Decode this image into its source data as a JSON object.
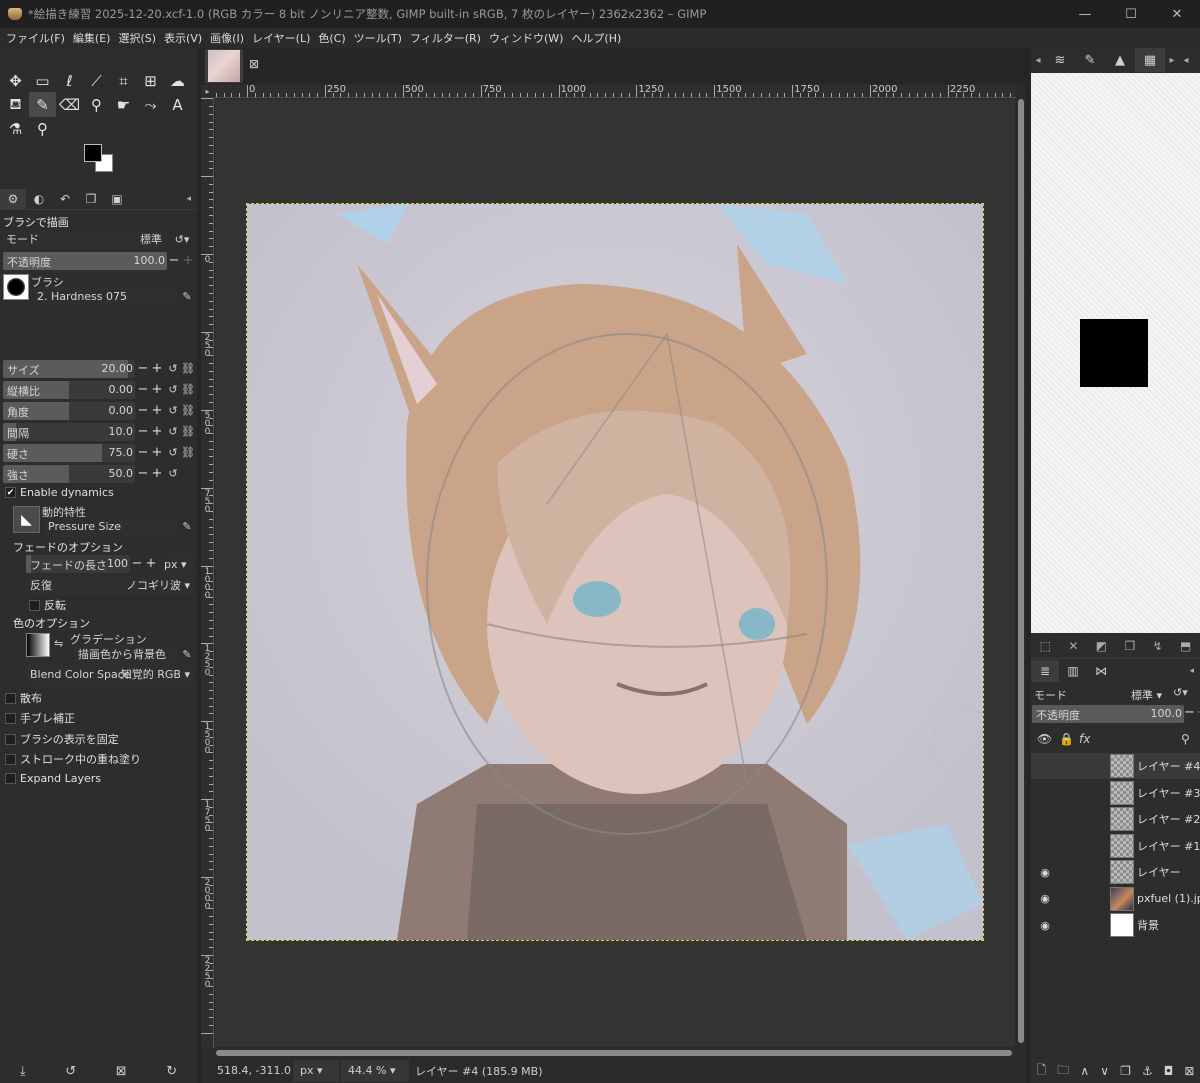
{
  "window": {
    "title": "*絵描き練習 2025-12-20.xcf-1.0 (RGB カラー 8 bit ノンリニア整数, GIMP built-in sRGB, 7 枚のレイヤー) 2362x2362 – GIMP",
    "minimize": "—",
    "maximize": "☐",
    "close": "✕"
  },
  "menubar": [
    "ファイル(F)",
    "編集(E)",
    "選択(S)",
    "表示(V)",
    "画像(I)",
    "レイヤー(L)",
    "色(C)",
    "ツール(T)",
    "フィルター(R)",
    "ウィンドウ(W)",
    "ヘルプ(H)"
  ],
  "toolbox": {
    "row1_icons": [
      "move-icon",
      "rect-select-icon",
      "free-select-icon",
      "fuzzy-select-icon",
      "crop-icon",
      "unified-transform-icon",
      "warp-icon"
    ],
    "row2_icons": [
      "bucket-fill-icon",
      "paintbrush-icon",
      "eraser-icon",
      "clone-icon",
      "smudge-icon",
      "path-icon",
      "text-icon"
    ],
    "row3_icons": [
      "color-picker-icon",
      "zoom-icon"
    ],
    "foreground_color": "#000000",
    "background_color": "#ffffff"
  },
  "tool_options": {
    "title": "ブラシで描画",
    "mode_label": "モード",
    "mode_value": "標準",
    "opacity": {
      "label": "不透明度",
      "value": "100.0"
    },
    "brush_label": "ブラシ",
    "brush_name": "2. Hardness 075",
    "sliders": [
      {
        "label": "サイズ",
        "value": "20.00",
        "fill": 0.95
      },
      {
        "label": "縦横比",
        "value": "0.00",
        "fill": 0.5
      },
      {
        "label": "角度",
        "value": "0.00",
        "fill": 0.5
      },
      {
        "label": "間隔",
        "value": "10.0",
        "fill": 0.1
      },
      {
        "label": "硬さ",
        "value": "75.0",
        "fill": 0.75
      },
      {
        "label": "強さ",
        "value": "50.0",
        "fill": 0.5
      }
    ],
    "enable_dynamics": "Enable dynamics",
    "dynamics_label": "動的特性",
    "dynamics_value": "Pressure Size",
    "fade_options": "フェードのオプション",
    "fade_length_label": "フェードの長さ",
    "fade_length_value": "100",
    "fade_unit": "px",
    "repeat_label": "反復",
    "repeat_value": "ノコギリ波",
    "reverse": "反転",
    "color_options": "色のオプション",
    "gradient_label": "グラデーション",
    "gradient_value": "描画色から背景色 (R",
    "blend_color_space_label": "Blend Color Space",
    "blend_color_space_value": "知覚的 RGB",
    "checkboxes": [
      "散布",
      "手ブレ補正",
      "ブラシの表示を固定",
      "ストローク中の重ね塗り",
      "Expand Layers"
    ]
  },
  "image_window": {
    "ruler_h": [
      "0",
      "250",
      "500",
      "750",
      "1000",
      "1250",
      "1500",
      "1750",
      "2000",
      "2250"
    ],
    "ruler_v": [
      "0",
      "250",
      "500",
      "750",
      "1000",
      "1250",
      "1500",
      "1750",
      "2000",
      "2250"
    ],
    "status": {
      "coords": "518.4, -311.0",
      "unit": "px",
      "zoom": "44.4 %",
      "message": "レイヤー #4 (185.9 MB)"
    }
  },
  "layers": {
    "mode_label": "モード",
    "mode_value": "標準",
    "opacity_label": "不透明度",
    "opacity_value": "100.0",
    "items": [
      {
        "name": "レイヤー #4",
        "visible": false,
        "thumb": "checker",
        "selected": true
      },
      {
        "name": "レイヤー #3",
        "visible": false,
        "thumb": "checker",
        "selected": false
      },
      {
        "name": "レイヤー #2",
        "visible": false,
        "thumb": "checker",
        "selected": false
      },
      {
        "name": "レイヤー #1",
        "visible": false,
        "thumb": "checker",
        "selected": false
      },
      {
        "name": "レイヤー",
        "visible": true,
        "thumb": "checker",
        "selected": false
      },
      {
        "name": "pxfuel (1).jpg",
        "visible": true,
        "thumb": "photo",
        "selected": false
      },
      {
        "name": "背景",
        "visible": true,
        "thumb": "white",
        "selected": false
      }
    ]
  }
}
